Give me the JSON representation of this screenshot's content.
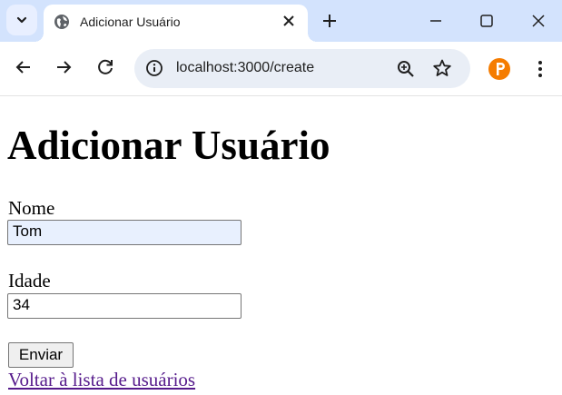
{
  "browser": {
    "tab_title": "Adicionar Usuário",
    "url": "localhost:3000/create"
  },
  "icons": {
    "tab_search": "chevron-down-icon",
    "favicon": "globe-icon",
    "tab_close": "close-icon",
    "new_tab": "plus-icon",
    "minimize": "minimize-icon",
    "maximize": "maximize-icon",
    "window_close": "close-icon",
    "back": "arrow-left-icon",
    "forward": "arrow-right-icon",
    "reload": "reload-icon",
    "site_info": "info-icon",
    "zoom": "zoom-in-icon",
    "bookmark": "star-icon",
    "extension": "extension-p-icon",
    "menu": "kebab-menu-icon"
  },
  "colors": {
    "tabstrip_bg": "#d3e3fd",
    "omnibox_bg": "#e9eef6",
    "autofill_bg": "#e8f0fe",
    "visited_link": "#551a8b",
    "extension_orange": "#f57c00"
  },
  "page": {
    "heading": "Adicionar Usuário",
    "name_label": "Nome",
    "name_value": "Tom",
    "age_label": "Idade",
    "age_value": "34",
    "submit_label": "Enviar",
    "back_link": "Voltar à lista de usuários"
  }
}
